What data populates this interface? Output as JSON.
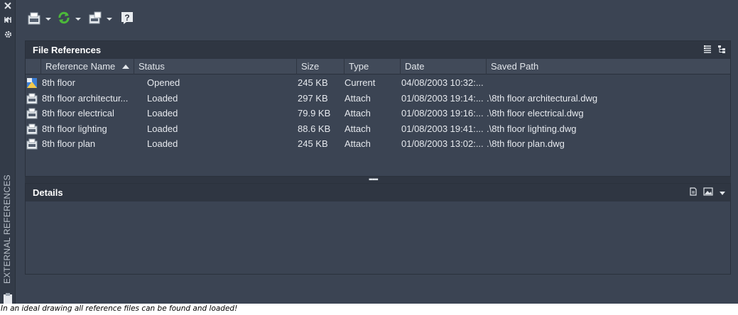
{
  "palette": {
    "panel_bg": "#3b4453",
    "header_bg": "#2f3642",
    "strip_bg": "#333b48",
    "text": "#e6e9ee",
    "refresh_green": "#4cb83a",
    "image_blue": "#3c7fd6"
  },
  "sidebar": {
    "title": "EXTERNAL REFERENCES",
    "icons": [
      "close-icon",
      "auto-hide-icon",
      "settings-icon",
      "clipboard-icon"
    ]
  },
  "toolbar": {
    "buttons": [
      {
        "name": "attach-dwg-button",
        "icon": "dwg-file-icon"
      },
      {
        "name": "refresh-button",
        "icon": "refresh-icon"
      },
      {
        "name": "change-path-button",
        "icon": "change-path-icon"
      },
      {
        "name": "help-button",
        "icon": "help-icon"
      }
    ]
  },
  "file_references": {
    "title": "File References",
    "header_icons": [
      "list-view-icon",
      "tree-view-icon"
    ],
    "columns": [
      "Reference Name",
      "Status",
      "Size",
      "Type",
      "Date",
      "Saved Path"
    ],
    "sort_column": "Reference Name",
    "sort_direction": "ascending",
    "rows": [
      {
        "icon": "host-drawing-icon",
        "name": "8th floor",
        "status": "Opened",
        "size": "245 KB",
        "type": "Current",
        "date": "04/08/2003 10:32:...",
        "path": ""
      },
      {
        "icon": "dwg-reference-icon",
        "name": "8th floor architectur...",
        "status": "Loaded",
        "size": "297 KB",
        "type": "Attach",
        "date": "01/08/2003 19:14:...",
        "path": ".\\8th floor architectural.dwg"
      },
      {
        "icon": "dwg-reference-icon",
        "name": "8th floor electrical",
        "status": "Loaded",
        "size": "79.9 KB",
        "type": "Attach",
        "date": "01/08/2003 19:16:...",
        "path": ".\\8th floor electrical.dwg"
      },
      {
        "icon": "dwg-reference-icon",
        "name": "8th floor lighting",
        "status": "Loaded",
        "size": "88.6 KB",
        "type": "Attach",
        "date": "01/08/2003 19:41:...",
        "path": ".\\8th floor lighting.dwg"
      },
      {
        "icon": "dwg-reference-icon",
        "name": "8th floor plan",
        "status": "Loaded",
        "size": "245 KB",
        "type": "Attach",
        "date": "01/08/2003 13:02:...",
        "path": ".\\8th floor plan.dwg"
      }
    ]
  },
  "details": {
    "title": "Details",
    "header_icons": [
      "details-icon",
      "preview-icon",
      "collapse-dropdown-icon"
    ]
  },
  "caption": "In an ideal drawing all reference files can be found and loaded!"
}
